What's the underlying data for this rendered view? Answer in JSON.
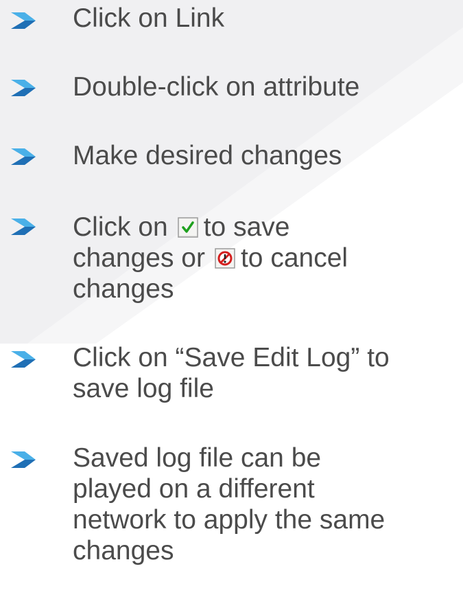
{
  "colors": {
    "background_light": "#f0f0f2",
    "background_white": "#ffffff",
    "text": "#4b4b4b",
    "arrow_dark": "#1f6fb5",
    "arrow_light": "#4ab0e8",
    "check_green": "#1ea01e",
    "cancel_red": "#d41e1e"
  },
  "icons": {
    "arrow": "arrow-bullet-icon",
    "save": "green-checkmark-icon",
    "cancel": "red-cancel-icon"
  },
  "items": [
    {
      "lines": [
        "Click on Link"
      ]
    },
    {
      "lines": [
        "Double-click on attribute"
      ]
    },
    {
      "lines": [
        "Make desired changes"
      ]
    },
    {
      "line1_before": "Click on",
      "line1_after": "to save",
      "line2_before": "changes or",
      "line2_after": "to cancel",
      "line3": "changes"
    },
    {
      "lines": [
        "Click on “Save Edit Log” to",
        "save log file"
      ]
    },
    {
      "lines": [
        "Saved log file can be",
        "played on a different",
        "network to apply the same",
        "changes"
      ]
    }
  ]
}
